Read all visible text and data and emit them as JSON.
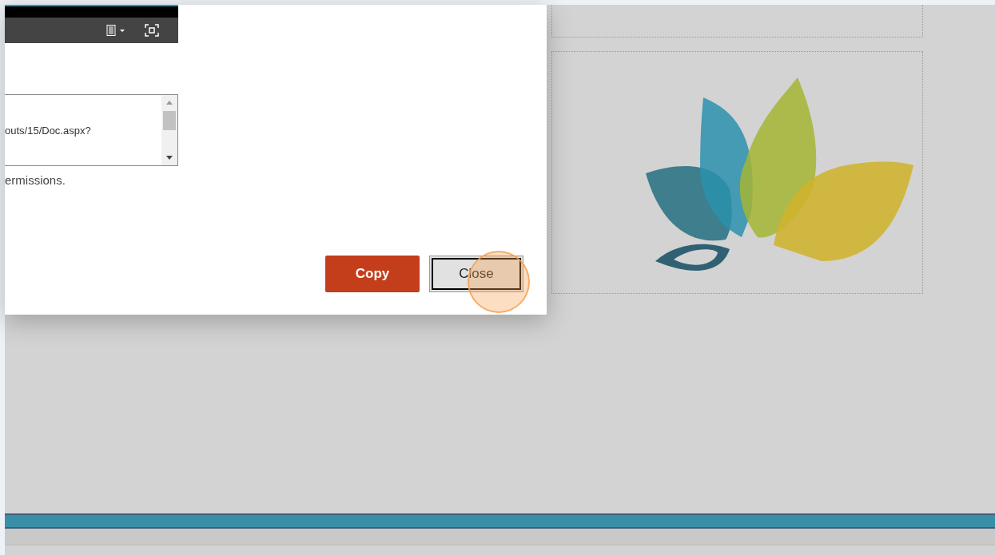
{
  "dialog": {
    "url_field": {
      "value": "outs/15/Doc.aspx?"
    },
    "note": "ermissions.",
    "buttons": [
      {
        "label": "Copy",
        "kind": "primary",
        "focused": false
      },
      {
        "label": "Close",
        "kind": "secondary",
        "focused": true
      }
    ]
  }
}
